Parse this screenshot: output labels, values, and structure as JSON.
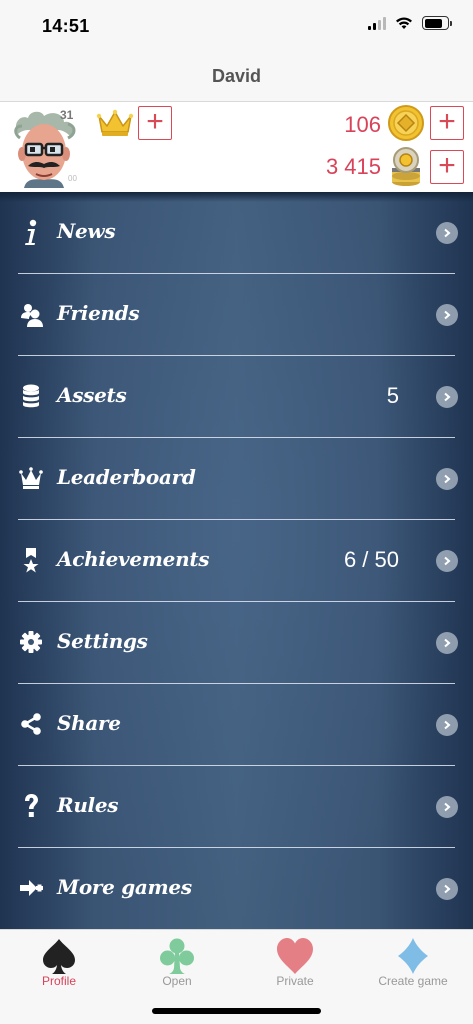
{
  "status_bar": {
    "time": "14:51",
    "icons": [
      "cellular-signal-icon",
      "wifi-icon",
      "battery-icon"
    ]
  },
  "nav": {
    "title": "David"
  },
  "profile": {
    "level": "31",
    "avatar_note": "00",
    "crown_icon": "crown-icon",
    "gold_coins": "106",
    "chips": "3 415",
    "add_label": "+"
  },
  "menu": {
    "items": [
      {
        "label": "News",
        "value": "",
        "icon": "info-icon"
      },
      {
        "label": "Friends",
        "value": "",
        "icon": "friends-icon"
      },
      {
        "label": "Assets",
        "value": "5",
        "icon": "coins-stack-icon"
      },
      {
        "label": "Leaderboard",
        "value": "",
        "icon": "crown-icon"
      },
      {
        "label": "Achievements",
        "value": "6 / 50",
        "icon": "ribbon-icon"
      },
      {
        "label": "Settings",
        "value": "",
        "icon": "gear-icon"
      },
      {
        "label": "Share",
        "value": "",
        "icon": "share-icon"
      },
      {
        "label": "Rules",
        "value": "",
        "icon": "question-icon"
      },
      {
        "label": "More games",
        "value": "",
        "icon": "arrow-plus-icon"
      }
    ]
  },
  "tabs": [
    {
      "label": "Profile",
      "icon": "spade-icon",
      "color": "#222222",
      "active": true
    },
    {
      "label": "Open",
      "icon": "club-icon",
      "color": "#7fcb9b",
      "active": false
    },
    {
      "label": "Private",
      "icon": "heart-icon",
      "color": "#e57f86",
      "active": false
    },
    {
      "label": "Create game",
      "icon": "diamond-icon",
      "color": "#7fbde7",
      "active": false
    }
  ],
  "colors": {
    "accent": "#d9435a",
    "menu_background": "#3a5474",
    "gold": "#f2c230"
  }
}
